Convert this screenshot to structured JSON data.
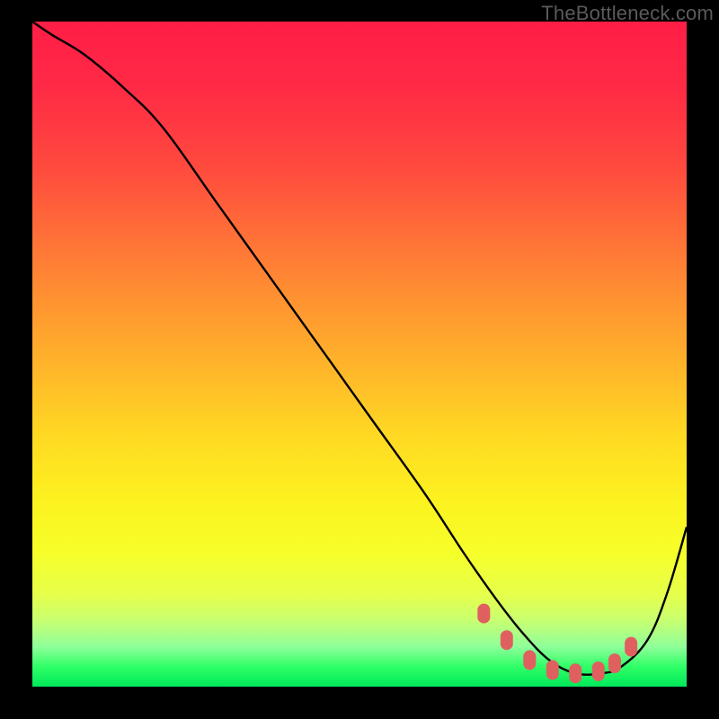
{
  "watermark": "TheBottleneck.com",
  "chart_data": {
    "type": "line",
    "title": "",
    "xlabel": "",
    "ylabel": "",
    "xlim": [
      0,
      100
    ],
    "ylim": [
      0,
      100
    ],
    "grid": false,
    "background_gradient": [
      "#ff1e46",
      "#ff9331",
      "#fcf21f",
      "#00e85a"
    ],
    "series": [
      {
        "name": "bottleneck-curve",
        "color": "#000000",
        "x": [
          0,
          3,
          8,
          14,
          20,
          28,
          36,
          44,
          52,
          60,
          66,
          71,
          75,
          79,
          83,
          87,
          90,
          94,
          97,
          100
        ],
        "y": [
          100,
          98,
          95,
          90,
          84,
          73,
          62,
          51,
          40,
          29,
          20,
          13,
          8,
          4,
          2,
          2,
          3,
          7,
          14,
          24
        ]
      }
    ],
    "markers": {
      "name": "optimal-range",
      "color": "#e06060",
      "shape": "rounded-rect",
      "x": [
        69,
        72.5,
        76,
        79.5,
        83,
        86.5,
        89,
        91.5
      ],
      "y": [
        11,
        7,
        4,
        2.5,
        2,
        2.3,
        3.5,
        6
      ]
    }
  }
}
